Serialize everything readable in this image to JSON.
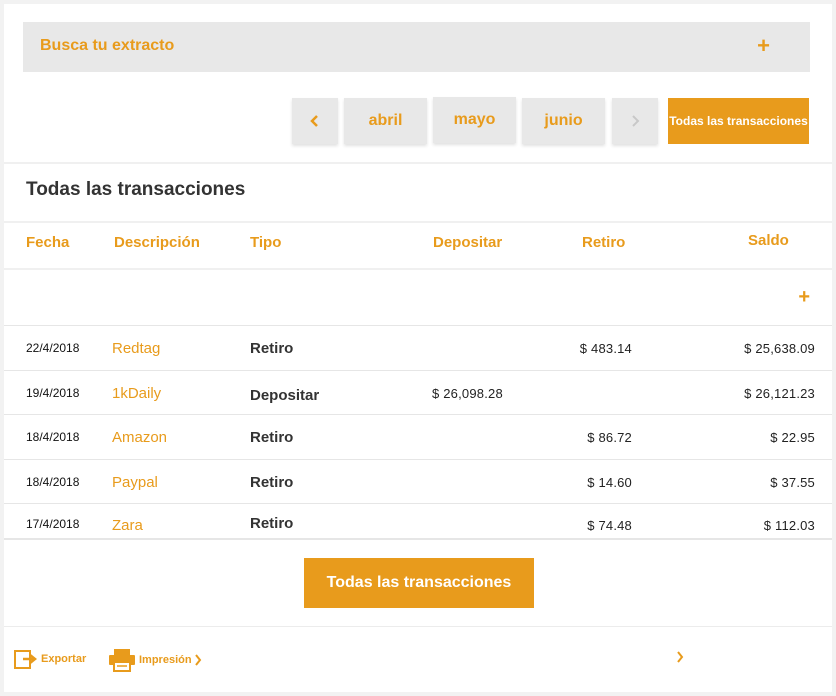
{
  "search": {
    "label": "Busca tu extracto",
    "plus": "+"
  },
  "month_nav": {
    "prev": "‹",
    "months": [
      "abril",
      "mayo",
      "junio"
    ],
    "next": "›",
    "all_label": "Todas las transacciones"
  },
  "section_title": "Todas las transacciones",
  "table": {
    "headers": [
      "Fecha",
      "Descripción",
      "Tipo",
      "Depositar",
      "Retiro",
      "Saldo"
    ],
    "expand": "+",
    "rows": [
      {
        "date": "22/4/2018",
        "desc": "Redtag",
        "type": "Retiro",
        "deposit": "",
        "withdraw": "$ 483.14",
        "balance": "$ 25,638.09"
      },
      {
        "date": "19/4/2018",
        "desc": "1kDaily",
        "type": "Depositar",
        "deposit": "$ 26,098.28",
        "withdraw": "",
        "balance": "$ 26,121.23"
      },
      {
        "date": "18/4/2018",
        "desc": "Amazon",
        "type": "Retiro",
        "deposit": "",
        "withdraw": "$ 86.72",
        "balance": "$ 22.95"
      },
      {
        "date": "18/4/2018",
        "desc": "Paypal",
        "type": "Retiro",
        "deposit": "",
        "withdraw": "$ 14.60",
        "balance": "$ 37.55"
      },
      {
        "date": "17/4/2018",
        "desc": "Zara",
        "type": "Retiro",
        "deposit": "",
        "withdraw": "$ 74.48",
        "balance": "$ 112.03"
      }
    ]
  },
  "all_transactions_button": "Todas las transacciones",
  "footer": {
    "export": "Exportar",
    "print": "Impresión",
    "chevron": "›"
  },
  "colors": {
    "accent": "#e89b1c",
    "panel": "#e8e8e8"
  }
}
